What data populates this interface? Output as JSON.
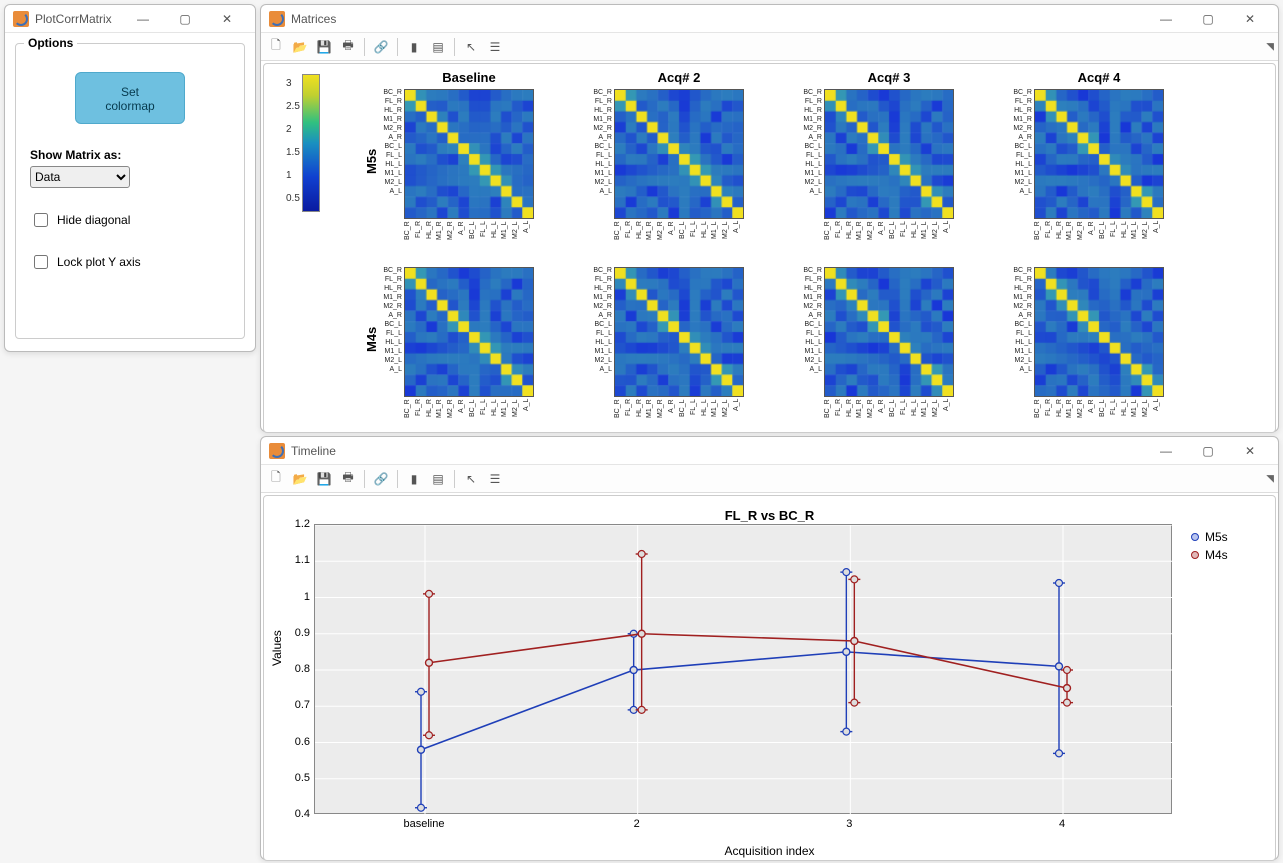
{
  "windows": {
    "options": {
      "title": "PlotCorrMatrix",
      "panel": {
        "legend": "Options",
        "set_cm_btn_l1": "Set",
        "set_cm_btn_l2": "colormap",
        "show_as_label": "Show Matrix as:",
        "show_as_value": "Data",
        "hide_diag_label": "Hide diagonal",
        "hide_diag_checked": false,
        "lock_y_label": "Lock plot Y axis",
        "lock_y_checked": false
      }
    },
    "matrices": {
      "title": "Matrices",
      "columns": [
        "Baseline",
        "Acq# 2",
        "Acq# 3",
        "Acq# 4"
      ],
      "rows": [
        "M5s",
        "M4s"
      ],
      "tick_labels": [
        "BC_R",
        "FL_R",
        "HL_R",
        "M1_R",
        "M2_R",
        "A_R",
        "BC_L",
        "FL_L",
        "HL_L",
        "M1_L",
        "M2_L",
        "A_L"
      ],
      "colorbar_ticks": [
        "3",
        "2.5",
        "2",
        "1.5",
        "1",
        "0.5"
      ]
    },
    "timeline": {
      "title": "Timeline",
      "chart_title": "FL_R vs BC_R",
      "ylabel": "Values",
      "xlabel": "Acquisition index",
      "legend": [
        "M5s",
        "M4s"
      ],
      "xticks": [
        "baseline",
        "2",
        "3",
        "4"
      ],
      "yticks": [
        "1.2",
        "1.1",
        "1",
        "0.9",
        "0.8",
        "0.7",
        "0.6",
        "0.5",
        "0.4"
      ]
    }
  },
  "chart_data": {
    "type": "line",
    "title": "FL_R vs BC_R",
    "xlabel": "Acquisition index",
    "ylabel": "Values",
    "ylim": [
      0.4,
      1.2
    ],
    "categories": [
      "baseline",
      "2",
      "3",
      "4"
    ],
    "series": [
      {
        "name": "M5s",
        "color": "#1f3fb8",
        "values": [
          0.58,
          0.8,
          0.85,
          0.81
        ],
        "err_low": [
          0.42,
          0.69,
          0.63,
          0.57
        ],
        "err_high": [
          0.74,
          0.9,
          1.07,
          1.04
        ]
      },
      {
        "name": "M4s",
        "color": "#a02020",
        "values": [
          0.82,
          0.9,
          0.88,
          0.75
        ],
        "err_low": [
          0.62,
          0.69,
          0.71,
          0.71
        ],
        "err_high": [
          1.01,
          1.12,
          1.05,
          0.8
        ]
      }
    ]
  }
}
